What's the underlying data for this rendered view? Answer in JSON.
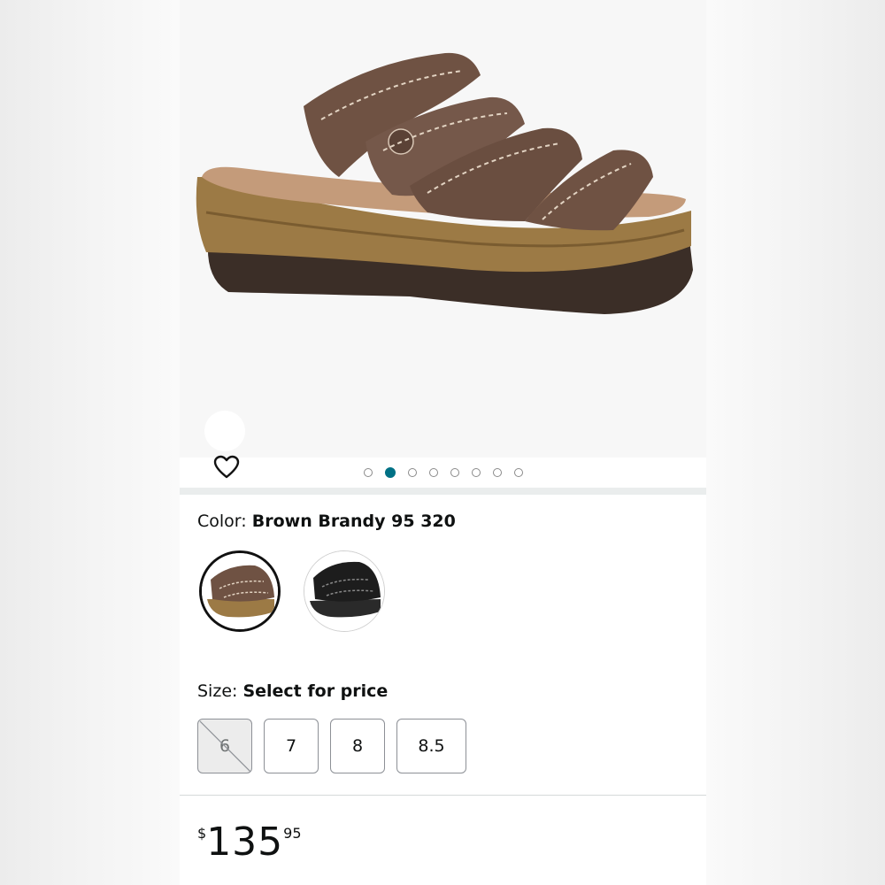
{
  "product": {
    "color_label": "Color:",
    "color_value": "Brown Brandy 95 320",
    "size_label": "Size:",
    "size_value": "Select for price",
    "image_carousel": {
      "total": 8,
      "active_index": 1
    },
    "swatches": [
      {
        "name": "brown-swatch",
        "color": "#6f5243",
        "selected": true
      },
      {
        "name": "black-swatch",
        "color": "#1d1d1d",
        "selected": false
      }
    ],
    "sizes": [
      {
        "label": "6",
        "available": false
      },
      {
        "label": "7",
        "available": true
      },
      {
        "label": "8",
        "available": true
      },
      {
        "label": "8.5",
        "available": true
      }
    ],
    "price": {
      "symbol": "$",
      "whole": "135",
      "fraction": "95"
    }
  },
  "icons": {
    "wishlist": "heart-outline-icon"
  },
  "colors": {
    "accent": "#007185",
    "text": "#0f1111",
    "border": "#8d9096"
  }
}
